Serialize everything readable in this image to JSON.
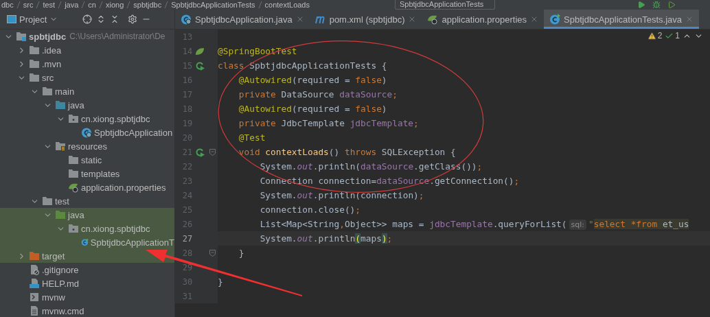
{
  "breadcrumbs": [
    "dbc",
    "src",
    "test",
    "java",
    "cn",
    "xiong",
    "spbtjdbc",
    "SpbtjdbcApplicationTests",
    "contextLoads"
  ],
  "run_config": "SpbtjdbcApplicationTests",
  "project_panel": {
    "title": "Project"
  },
  "tabs": [
    {
      "label": "SpbtjdbcApplication.java",
      "kind": "app_class",
      "selected": false
    },
    {
      "label": "pom.xml (spbtjdbc)",
      "kind": "maven",
      "selected": false
    },
    {
      "label": "application.properties",
      "kind": "properties",
      "selected": false
    },
    {
      "label": "SpbtjdbcApplicationTests.java",
      "kind": "test_class",
      "selected": true
    }
  ],
  "tree": [
    {
      "name": "spbtjdbc",
      "path": "C:\\Users\\Administrator\\De",
      "kind": "module",
      "expanded": true,
      "tinted": false,
      "children": [
        {
          "name": ".idea",
          "kind": "folder",
          "expanded": false,
          "tinted": false
        },
        {
          "name": ".mvn",
          "kind": "folder",
          "expanded": false,
          "tinted": false
        },
        {
          "name": "src",
          "kind": "folder",
          "expanded": true,
          "tinted": false,
          "children": [
            {
              "name": "main",
              "kind": "folder",
              "expanded": true,
              "tinted": false,
              "children": [
                {
                  "name": "java",
                  "kind": "source_folder",
                  "expanded": true,
                  "tinted": false,
                  "children": [
                    {
                      "name": "cn.xiong.spbtjdbc",
                      "kind": "package",
                      "expanded": true,
                      "tinted": false,
                      "children": [
                        {
                          "name": "SpbtjdbcApplication",
                          "kind": "app_class",
                          "tinted": false
                        }
                      ]
                    }
                  ]
                },
                {
                  "name": "resources",
                  "kind": "resource_folder",
                  "expanded": true,
                  "tinted": false,
                  "children": [
                    {
                      "name": "static",
                      "kind": "folder",
                      "tinted": false
                    },
                    {
                      "name": "templates",
                      "kind": "folder",
                      "tinted": false
                    },
                    {
                      "name": "application.properties",
                      "kind": "properties",
                      "tinted": false
                    }
                  ]
                }
              ]
            },
            {
              "name": "test",
              "kind": "folder",
              "expanded": true,
              "tinted": false,
              "children": [
                {
                  "name": "java",
                  "kind": "test_folder",
                  "expanded": true,
                  "tinted": true,
                  "children": [
                    {
                      "name": "cn.xiong.spbtjdbc",
                      "kind": "package",
                      "expanded": true,
                      "tinted": true,
                      "children": [
                        {
                          "name": "SpbtjdbcApplicationT",
                          "kind": "test_class",
                          "tinted": true
                        }
                      ]
                    }
                  ]
                }
              ]
            }
          ]
        },
        {
          "name": "target",
          "kind": "excluded_folder",
          "expanded": false,
          "tinted": true
        },
        {
          "name": ".gitignore",
          "kind": "ignore_file",
          "tinted": false
        },
        {
          "name": "HELP.md",
          "kind": "markdown",
          "tinted": false
        },
        {
          "name": "mvnw",
          "kind": "shell",
          "tinted": false
        },
        {
          "name": "mvnw.cmd",
          "kind": "text_file",
          "tinted": false
        }
      ]
    }
  ],
  "inspections": [
    {
      "kind": "warning",
      "count": "2"
    },
    {
      "kind": "ok",
      "count": "1"
    }
  ],
  "editor": {
    "lines": [
      {
        "number": "13",
        "kind": "plain",
        "fold": false,
        "current": false
      },
      {
        "number": "14",
        "kind": "spring",
        "fold": false,
        "current": false,
        "tokens": [
          {
            "text": "@SpringBootTest",
            "kind": "annotation"
          }
        ]
      },
      {
        "number": "15",
        "kind": "run",
        "fold": false,
        "current": false,
        "tokens": [
          {
            "text": "class ",
            "kind": "keyword"
          },
          {
            "text": "SpbtjdbcApplicationTests {",
            "kind": "plain"
          }
        ]
      },
      {
        "number": "16",
        "kind": "plain",
        "fold": false,
        "current": false,
        "tokens": [
          {
            "text": "    @Autowired",
            "kind": "annotation"
          },
          {
            "text": "(required = ",
            "kind": "plain"
          },
          {
            "text": "false",
            "kind": "keyword"
          },
          {
            "text": ")",
            "kind": "plain"
          }
        ]
      },
      {
        "number": "17",
        "kind": "plain",
        "fold": false,
        "current": false,
        "tokens": [
          {
            "text": "    private ",
            "kind": "keyword"
          },
          {
            "text": "DataSource ",
            "kind": "plain"
          },
          {
            "text": "dataSource",
            "kind": "field"
          },
          {
            "text": ";",
            "kind": "keyword"
          }
        ]
      },
      {
        "number": "18",
        "kind": "plain",
        "fold": false,
        "current": false,
        "tokens": [
          {
            "text": "    @Autowired",
            "kind": "annotation"
          },
          {
            "text": "(required = ",
            "kind": "plain"
          },
          {
            "text": "false",
            "kind": "keyword"
          },
          {
            "text": ")",
            "kind": "plain"
          }
        ]
      },
      {
        "number": "19",
        "kind": "plain",
        "fold": false,
        "current": false,
        "tokens": [
          {
            "text": "    private ",
            "kind": "keyword"
          },
          {
            "text": "JdbcTemplate ",
            "kind": "plain"
          },
          {
            "text": "jdbcTemplate",
            "kind": "field"
          },
          {
            "text": ";",
            "kind": "keyword"
          }
        ]
      },
      {
        "number": "20",
        "kind": "plain",
        "fold": false,
        "current": false,
        "tokens": [
          {
            "text": "    @Test",
            "kind": "annotation"
          }
        ]
      },
      {
        "number": "21",
        "kind": "run",
        "fold": true,
        "current": false,
        "tokens": [
          {
            "text": "    void ",
            "kind": "keyword"
          },
          {
            "text": "contextLoads",
            "kind": "method"
          },
          {
            "text": "() ",
            "kind": "plain"
          },
          {
            "text": "throws ",
            "kind": "keyword"
          },
          {
            "text": "SQLException {",
            "kind": "plain"
          }
        ]
      },
      {
        "number": "22",
        "kind": "plain",
        "fold": false,
        "current": false,
        "tokens": [
          {
            "text": "        System.",
            "kind": "plain"
          },
          {
            "text": "out",
            "kind": "static"
          },
          {
            "text": ".println(",
            "kind": "plain"
          },
          {
            "text": "dataSource",
            "kind": "field"
          },
          {
            "text": ".getClass())",
            "kind": "plain"
          },
          {
            "text": ";",
            "kind": "keyword"
          }
        ]
      },
      {
        "number": "23",
        "kind": "plain",
        "fold": false,
        "current": false,
        "tokens": [
          {
            "text": "        Connection connection=",
            "kind": "plain"
          },
          {
            "text": "dataSource",
            "kind": "field"
          },
          {
            "text": ".getConnection()",
            "kind": "plain"
          },
          {
            "text": ";",
            "kind": "keyword"
          }
        ]
      },
      {
        "number": "24",
        "kind": "plain",
        "fold": false,
        "current": false,
        "tokens": [
          {
            "text": "        System.",
            "kind": "plain"
          },
          {
            "text": "out",
            "kind": "static"
          },
          {
            "text": ".println(connection)",
            "kind": "plain"
          },
          {
            "text": ";",
            "kind": "keyword"
          }
        ]
      },
      {
        "number": "25",
        "kind": "plain",
        "fold": false,
        "current": false,
        "tokens": [
          {
            "text": "        connection.close()",
            "kind": "plain"
          },
          {
            "text": ";",
            "kind": "keyword"
          }
        ]
      },
      {
        "number": "26",
        "kind": "plain",
        "fold": false,
        "current": false,
        "tokens": [
          {
            "text": "        List<Map<String",
            "kind": "plain"
          },
          {
            "text": ",",
            "kind": "keyword"
          },
          {
            "text": "Object>> maps = ",
            "kind": "plain"
          },
          {
            "text": "jdbcTemplate",
            "kind": "field"
          },
          {
            "text": ".queryForList(",
            "kind": "plain"
          },
          {
            "text": "sql:",
            "kind": "hint"
          },
          {
            "text": "\"",
            "kind": "string"
          },
          {
            "text": "select *from",
            "kind": "sql_keyword"
          },
          {
            "text": " et_us",
            "kind": "sql_text"
          }
        ]
      },
      {
        "number": "27",
        "kind": "plain",
        "fold": false,
        "current": true,
        "tokens": [
          {
            "text": "        System.",
            "kind": "plain"
          },
          {
            "text": "out",
            "kind": "static"
          },
          {
            "text": ".println",
            "kind": "plain"
          },
          {
            "text": "(",
            "kind": "bracket_match"
          },
          {
            "text": "maps",
            "kind": "plain"
          },
          {
            "text": ")",
            "kind": "bracket_match"
          },
          {
            "text": ";",
            "kind": "keyword"
          }
        ]
      },
      {
        "number": "28",
        "kind": "plain",
        "fold": true,
        "current": false,
        "tokens": [
          {
            "text": "    }",
            "kind": "plain"
          }
        ]
      },
      {
        "number": "29",
        "kind": "plain",
        "fold": false,
        "current": false
      },
      {
        "number": "30",
        "kind": "plain",
        "fold": false,
        "current": false,
        "tokens": [
          {
            "text": "}",
            "kind": "plain"
          }
        ]
      },
      {
        "number": "31",
        "kind": "plain",
        "fold": false,
        "current": false
      }
    ]
  }
}
